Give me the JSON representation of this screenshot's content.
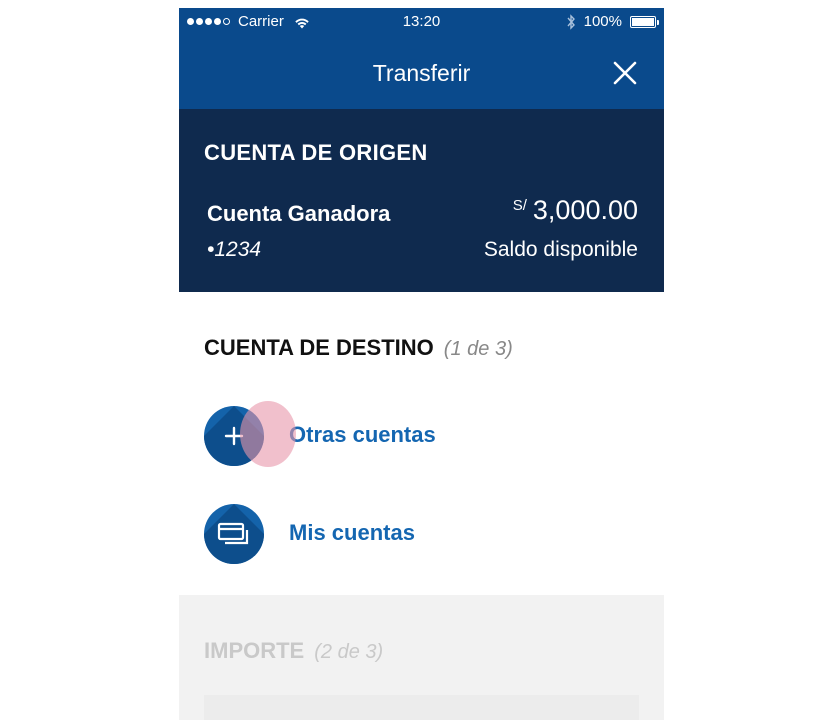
{
  "status_bar": {
    "carrier": "Carrier",
    "time": "13:20",
    "battery": "100%"
  },
  "header": {
    "title": "Transferir"
  },
  "origin": {
    "heading": "CUENTA DE ORIGEN",
    "account_name": "Cuenta Ganadora",
    "account_number": "•1234",
    "currency": "S/",
    "balance": "3,000.00",
    "balance_label": "Saldo disponible"
  },
  "destination": {
    "heading": "CUENTA DE DESTINO",
    "step": "(1 de 3)",
    "options": [
      {
        "label": "Otras cuentas",
        "icon": "plus-icon"
      },
      {
        "label": "Mis cuentas",
        "icon": "cards-icon"
      }
    ]
  },
  "amount": {
    "heading": "IMPORTE",
    "step": "(2 de 3)"
  },
  "colors": {
    "header_blue": "#0a4a8c",
    "origin_navy": "#0f2a4e",
    "link_blue": "#1466b1",
    "disabled_gray": "#c9c9c9"
  }
}
